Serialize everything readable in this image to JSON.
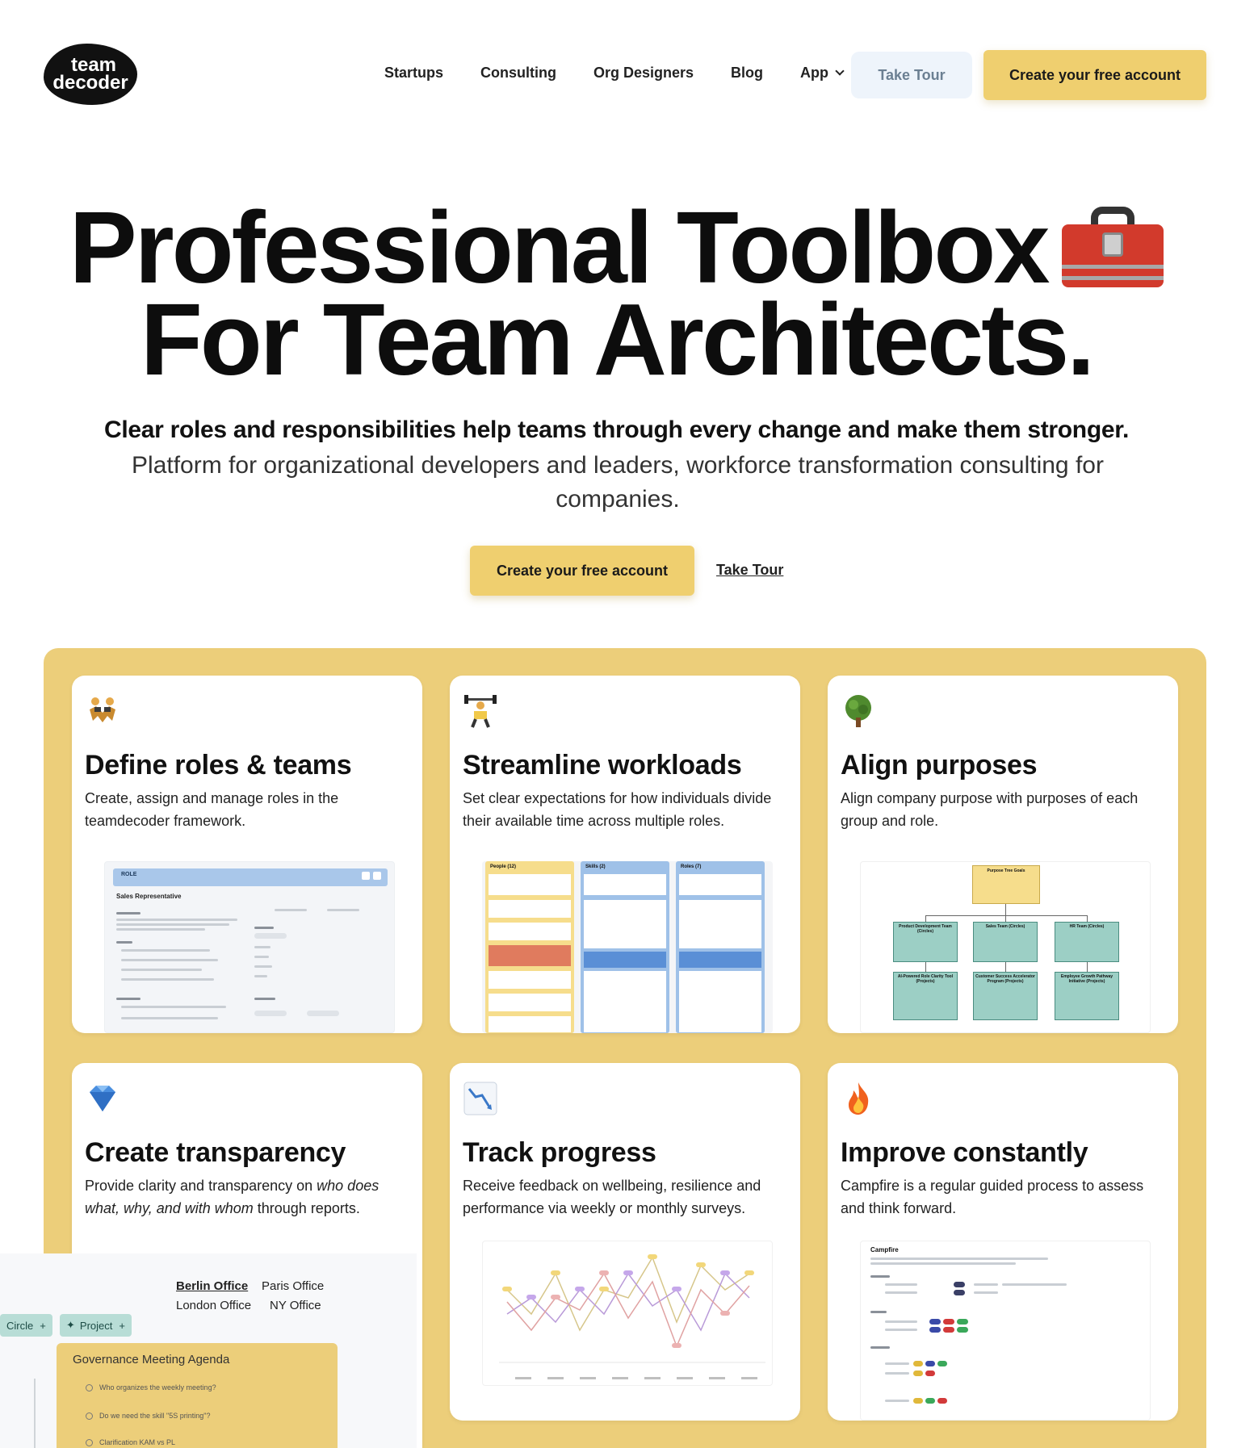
{
  "nav": {
    "logo_line1": "team",
    "logo_line2": "decoder",
    "links": [
      "Startups",
      "Consulting",
      "Org Designers",
      "Blog",
      "App"
    ],
    "tour_label": "Take Tour",
    "cta_label": "Create your free account"
  },
  "hero": {
    "title_line1": "Professional Toolbox",
    "title_emoji": "toolbox-icon",
    "title_line2": "For Team Architects.",
    "subtitle_bold": "Clear roles and responsibilities help teams through every change and make them stronger.",
    "subtitle_regular": "Platform for organizational developers and leaders, workforce transformation consulting for companies.",
    "cta_label": "Create your free account",
    "tour_label": "Take Tour"
  },
  "features": [
    {
      "icon": "people-wrestling-icon",
      "title": "Define roles & teams",
      "desc": "Create, assign and manage roles in the teamdecoder framework."
    },
    {
      "icon": "weight-lifter-icon",
      "title": "Streamline workloads",
      "desc": "Set clear expectations for how individuals divide their available time across multiple roles."
    },
    {
      "icon": "tree-icon",
      "title": "Align purposes",
      "desc": "Align company purpose with purposes of each group and role."
    },
    {
      "icon": "gem-icon",
      "title": "Create transparency",
      "desc_parts": [
        "Provide clarity and transparency on ",
        "who does what, why, and with whom",
        " through reports."
      ]
    },
    {
      "icon": "chart-decreasing-icon",
      "title": "Track progress",
      "desc": "Receive feedback on wellbeing, resilience and performance via weekly or monthly surveys."
    },
    {
      "icon": "fire-icon",
      "title": "Improve constantly",
      "desc": "Campfire is a regular guided process to assess and think forward."
    }
  ],
  "screens": {
    "role": {
      "header": "ROLE",
      "title": "Sales Representative"
    },
    "workload": {
      "columns": [
        "People (12)",
        "Skills (2)",
        "Roles (7)"
      ]
    },
    "purpose": {
      "root": "Purpose Tree Goals",
      "level1": [
        "Product Development Team (Circles)",
        "Sales Team (Circles)",
        "HR Team (Circles)"
      ],
      "level2": [
        "AI-Powered Role Clarity Tool (Projects)",
        "Customer Success Accelerator Program (Projects)",
        "Employee Growth Pathway Initiative (Projects)"
      ]
    },
    "campfire": {
      "title": "Campfire"
    }
  },
  "overlay": {
    "offices": [
      "Berlin Office",
      "Paris Office",
      "London Office",
      "NY Office"
    ],
    "chips": [
      "Circle",
      "Project"
    ],
    "agenda_title": "Governance Meeting Agenda",
    "agenda_items": [
      "Who organizes the weekly meeting?",
      "Do we need the skill \"5S printing\"?",
      "Clarification KAM vs PL"
    ]
  },
  "colors": {
    "accent": "#efcf6f",
    "panel": "#ecce7a",
    "teal": "#b8ddd6"
  }
}
